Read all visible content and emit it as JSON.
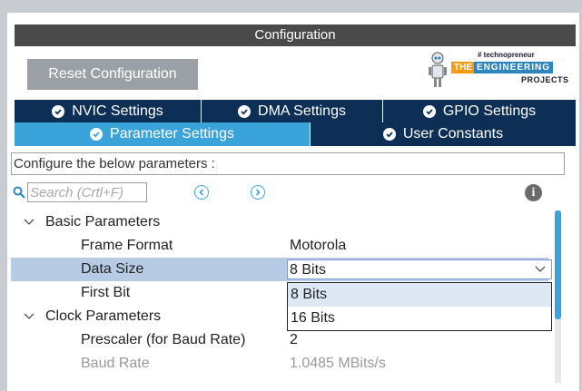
{
  "header": {
    "title": "Configuration"
  },
  "toolbar": {
    "reset_label": "Reset Configuration"
  },
  "logo": {
    "tagline": "# technopreneur",
    "the": "THE",
    "engineering": "ENGINEERING",
    "projects": "PROJECTS"
  },
  "tabs": {
    "row1": [
      {
        "label": "NVIC Settings"
      },
      {
        "label": "DMA Settings"
      },
      {
        "label": "GPIO Settings"
      }
    ],
    "row2": [
      {
        "label": "Parameter Settings",
        "active": true
      },
      {
        "label": "User Constants"
      }
    ]
  },
  "description": "Configure the below parameters :",
  "search": {
    "placeholder": "Search (Crtl+F)"
  },
  "info_icon": "i",
  "groups": {
    "basic": {
      "label": "Basic Parameters"
    },
    "clock": {
      "label": "Clock Parameters"
    }
  },
  "params": {
    "frame_format": {
      "name": "Frame Format",
      "value": "Motorola"
    },
    "data_size": {
      "name": "Data Size",
      "value": "8 Bits"
    },
    "first_bit": {
      "name": "First Bit"
    },
    "prescaler": {
      "name": "Prescaler (for Baud Rate)",
      "value": "2"
    },
    "baud_rate": {
      "name": "Baud Rate",
      "value": "1.0485 MBits/s"
    }
  },
  "dropdown": {
    "options": [
      "8 Bits",
      "16 Bits"
    ]
  },
  "colors": {
    "tab_dark": "#0d2f56",
    "tab_active": "#3aa3d9",
    "selected_row": "#b8cbe4",
    "header_bg": "#4a4a4a"
  }
}
